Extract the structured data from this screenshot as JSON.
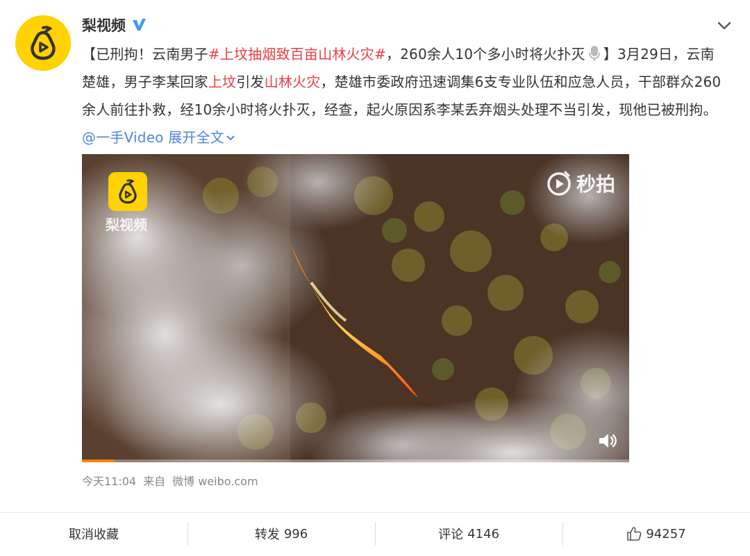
{
  "post": {
    "author": "梨视频",
    "content": {
      "bracket_open": "【",
      "lead": "已刑拘！云南男子",
      "hashtag": "#上坟抽烟致百亩山林火灾#",
      "after_tag": "，260余人10个多小时将火扑灭",
      "bracket_close": "】",
      "p1": "3月29日，云南楚雄，男子李某回家",
      "hl1": "上坟",
      "p2": "引发",
      "hl2": "山林火灾",
      "p3": "，楚雄市委政府迅速调集6支专业队伍和应急人员，干部群众260余人前往扑救，经10余小时将火扑灭，经查，起火原因系李某丢弃烟头处理不当引发，现他已被刑拘。",
      "mention": "@一手Video",
      "expand": "展开全文"
    },
    "video": {
      "watermark_text": "梨视频",
      "miaopai_text": "秒拍",
      "progress": 0.06
    },
    "meta": {
      "time": "今天11:04",
      "source_label": "来自",
      "source": "微博 weibo.com"
    }
  },
  "footer": {
    "favorite": "取消收藏",
    "repost_label": "转发",
    "repost_count": "996",
    "comment_label": "评论",
    "comment_count": "4146",
    "like_count": "94257"
  },
  "colors": {
    "brand_yellow": "#ffd200",
    "highlight_red": "#eb3d43",
    "link_blue": "#4f84e0",
    "progress_orange": "#ff8200"
  },
  "icons": [
    "pear-video-logo-icon",
    "verified-v-icon",
    "chevron-down-icon",
    "voice-icon",
    "miaopai-logo-icon",
    "volume-icon",
    "like-thumb-icon"
  ]
}
